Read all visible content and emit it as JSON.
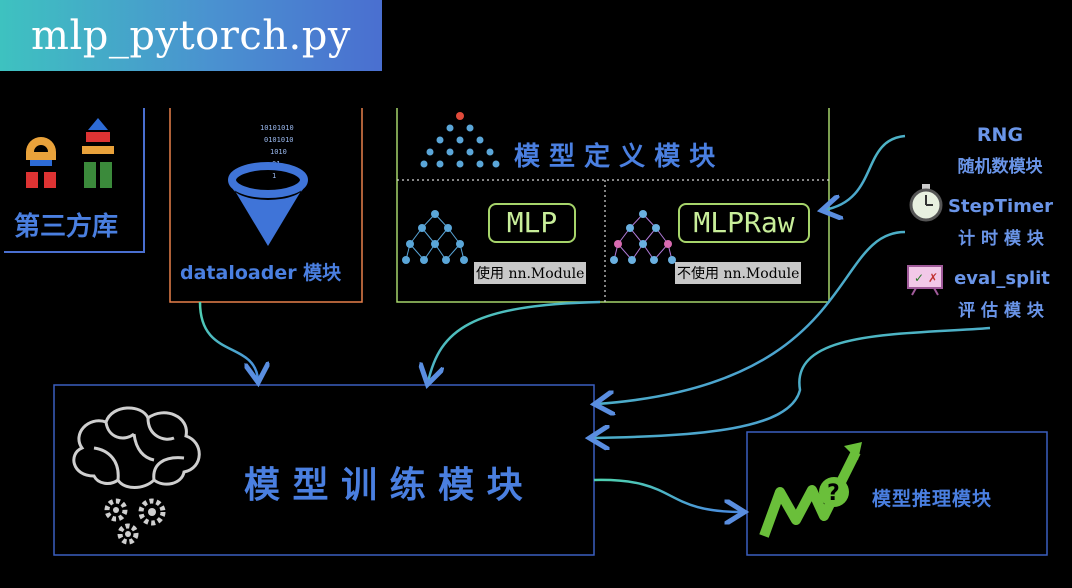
{
  "title": "mlp_pytorch.py",
  "third_party": {
    "label": "第三方库"
  },
  "dataloader": {
    "label": "dataloader 模块"
  },
  "model_def": {
    "label": "模 型 定 义 模 块",
    "mlp": {
      "name": "MLP",
      "caption": "使用 nn.Module"
    },
    "mlpraw": {
      "name": "MLPRaw",
      "caption": "不使用 nn.Module"
    }
  },
  "utils": {
    "rng": {
      "name": "RNG",
      "desc": "随机数模块"
    },
    "steptimer": {
      "name": "StepTimer",
      "desc": "计 时 模 块"
    },
    "evalsplit": {
      "name": "eval_split",
      "desc": "评 估 模 块"
    }
  },
  "training": {
    "label": "模 型 训 练 模 块"
  },
  "inference": {
    "label": "模型推理模块"
  },
  "colors": {
    "blue_text": "#4a7fe0",
    "green": "#a6d46a",
    "orange": "#e8804a",
    "teal": "#4fd1b0"
  }
}
